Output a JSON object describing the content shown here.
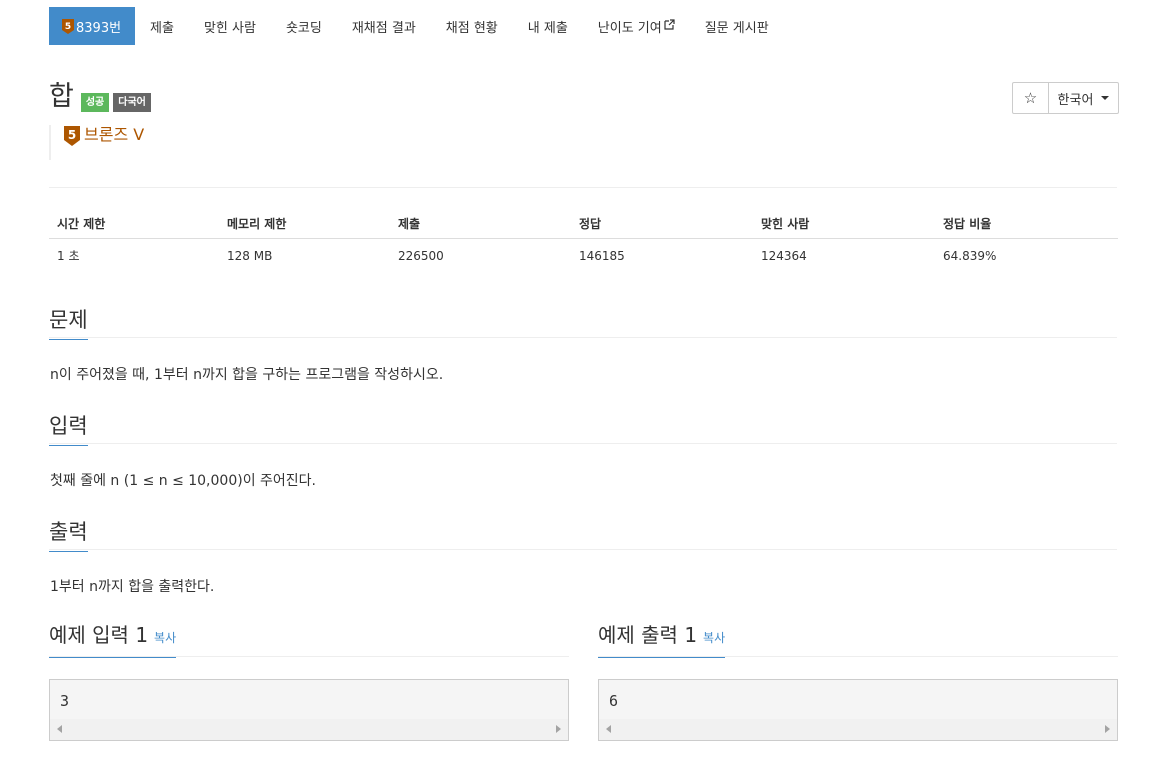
{
  "nav": {
    "problem_tab": "8393번",
    "tier_number": "5",
    "tabs": [
      "제출",
      "맞힌 사람",
      "숏코딩",
      "재채점 결과",
      "채점 현황",
      "내 제출",
      "난이도 기여",
      "질문 게시판"
    ]
  },
  "problem": {
    "title": "합",
    "label_success": "성공",
    "label_multilang": "다국어",
    "tier_number": "5",
    "tier_name": "브론즈 V"
  },
  "controls": {
    "star_icon": "☆",
    "language": "한국어"
  },
  "info_table": {
    "headers": [
      "시간 제한",
      "메모리 제한",
      "제출",
      "정답",
      "맞힌 사람",
      "정답 비율"
    ],
    "values": [
      "1 초",
      "128 MB",
      "226500",
      "146185",
      "124364",
      "64.839%"
    ]
  },
  "sections": {
    "description_title": "문제",
    "description": "n이 주어졌을 때, 1부터 n까지 합을 구하는 프로그램을 작성하시오.",
    "input_title": "입력",
    "input": "첫째 줄에 n (1 ≤ n ≤ 10,000)이 주어진다.",
    "output_title": "출력",
    "output": "1부터 n까지 합을 출력한다."
  },
  "samples": {
    "input_title": "예제 입력 1",
    "input_copy": "복사",
    "input_value": "3",
    "output_title": "예제 출력 1",
    "output_copy": "복사",
    "output_value": "6"
  },
  "colors": {
    "accent": "#428bca",
    "success": "#5cb85c",
    "bronze": "#ad5600"
  }
}
